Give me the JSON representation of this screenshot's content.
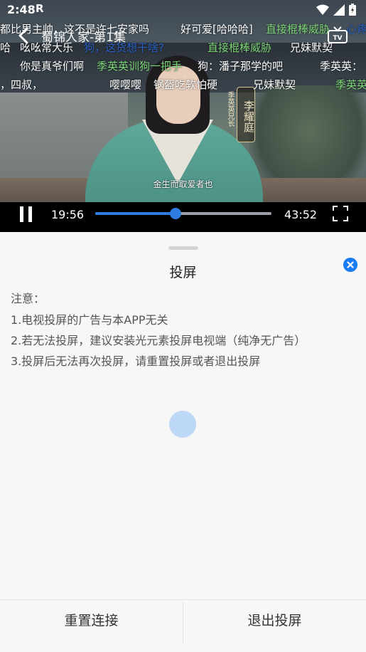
{
  "status_bar": {
    "time": "2:48",
    "indicator": "R",
    "icons": [
      "wifi-icon",
      "signal-icon",
      "battery-icon"
    ]
  },
  "player": {
    "title": "蜀锦人家-第1集",
    "current_time": "19:56",
    "total_time": "43:52",
    "progress": 0.4544,
    "subtitle": "金生而取爱者也",
    "name_plate": "李耀庭",
    "name_plate_sub": "季英英兄长",
    "accent_color": "#2f7de1"
  },
  "danmaku": [
    {
      "text": "都比男主帅，这不是许七安家吗",
      "color": "white"
    },
    {
      "text": "好可爱[哈哈哈]",
      "color": "white"
    },
    {
      "text": "直接棍棒威胁",
      "color": "green"
    },
    {
      "text": "心疼",
      "color": "blue"
    },
    {
      "text": "哈",
      "color": "white"
    },
    {
      "text": "吆吆常大乐",
      "color": "white"
    },
    {
      "text": "狗，这货想干啥?",
      "color": "blue"
    },
    {
      "text": "直接棍棒威胁",
      "color": "green"
    },
    {
      "text": "兄妹默契",
      "color": "white"
    },
    {
      "text": "你是真爷们啊",
      "color": "white"
    },
    {
      "text": "季英英训狗一把手",
      "color": "green"
    },
    {
      "text": "狗：潘子那学的吧",
      "color": "white"
    },
    {
      "text": "季英英：",
      "color": "white"
    },
    {
      "text": "，四叔，",
      "color": "white"
    },
    {
      "text": "嘤嘤嘤",
      "color": "white"
    },
    {
      "text": "锅盔吃软怕硬",
      "color": "white"
    },
    {
      "text": "兄妹默契",
      "color": "white"
    },
    {
      "text": "季英英",
      "color": "green"
    }
  ],
  "sheet": {
    "title": "投屏",
    "notes": [
      "注意：",
      "1.电视投屏的广告与本APP无关",
      "2.若无法投屏，建议安装光元素投屏电视端（纯净无广告）",
      "3.投屏后无法再次投屏，请重置投屏或者退出投屏"
    ],
    "reset_button": "重置连接",
    "exit_button": "退出投屏"
  }
}
